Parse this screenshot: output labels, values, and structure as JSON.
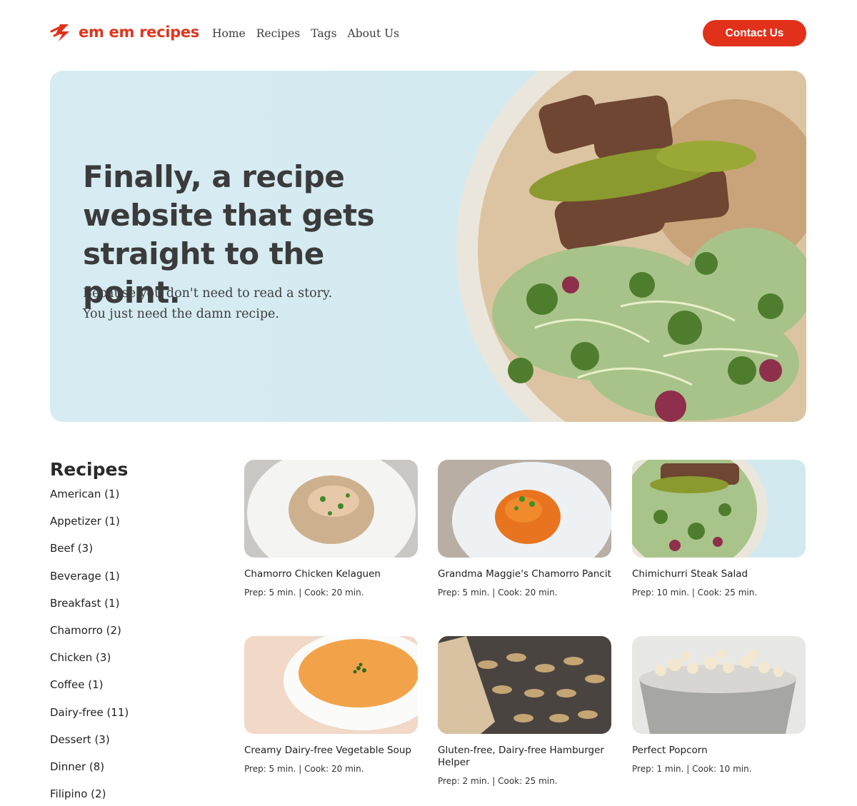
{
  "site": {
    "logo_text": "em em recipes",
    "logo_icon": "lightning-swoosh-icon",
    "brand_color": "#e2311a"
  },
  "nav": {
    "items": [
      {
        "label": "Home"
      },
      {
        "label": "Recipes"
      },
      {
        "label": "Tags"
      },
      {
        "label": "About Us"
      }
    ],
    "contact_label": "Contact Us"
  },
  "hero": {
    "title": "Finally, a recipe website that gets straight to the point.",
    "subtitle_line1": "Because you don't need to read a story.",
    "subtitle_line2": "You just need the damn recipe."
  },
  "sidebar": {
    "heading": "Recipes",
    "categories": [
      {
        "label": "American (1)"
      },
      {
        "label": "Appetizer (1)"
      },
      {
        "label": "Beef (3)"
      },
      {
        "label": "Beverage (1)"
      },
      {
        "label": "Breakfast (1)"
      },
      {
        "label": "Chamorro (2)"
      },
      {
        "label": "Chicken (3)"
      },
      {
        "label": "Coffee (1)"
      },
      {
        "label": "Dairy-free (11)"
      },
      {
        "label": "Dessert (3)"
      },
      {
        "label": "Dinner (8)"
      },
      {
        "label": "Filipino (2)"
      }
    ]
  },
  "recipes": [
    {
      "title": "Chamorro Chicken Kelaguen",
      "meta": "Prep: 5 min. | Cook: 20 min."
    },
    {
      "title": "Grandma Maggie's Chamorro Pancit",
      "meta": "Prep: 5 min. | Cook: 20 min."
    },
    {
      "title": "Chimichurri Steak Salad",
      "meta": "Prep: 10 min. | Cook: 25 min."
    },
    {
      "title": "Creamy Dairy-free Vegetable Soup",
      "meta": "Prep: 5 min. | Cook: 20 min."
    },
    {
      "title": "Gluten-free, Dairy-free Hamburger Helper",
      "meta": "Prep: 2 min. | Cook: 25 min."
    },
    {
      "title": "Perfect Popcorn",
      "meta": "Prep: 1 min. | Cook: 10 min."
    }
  ]
}
